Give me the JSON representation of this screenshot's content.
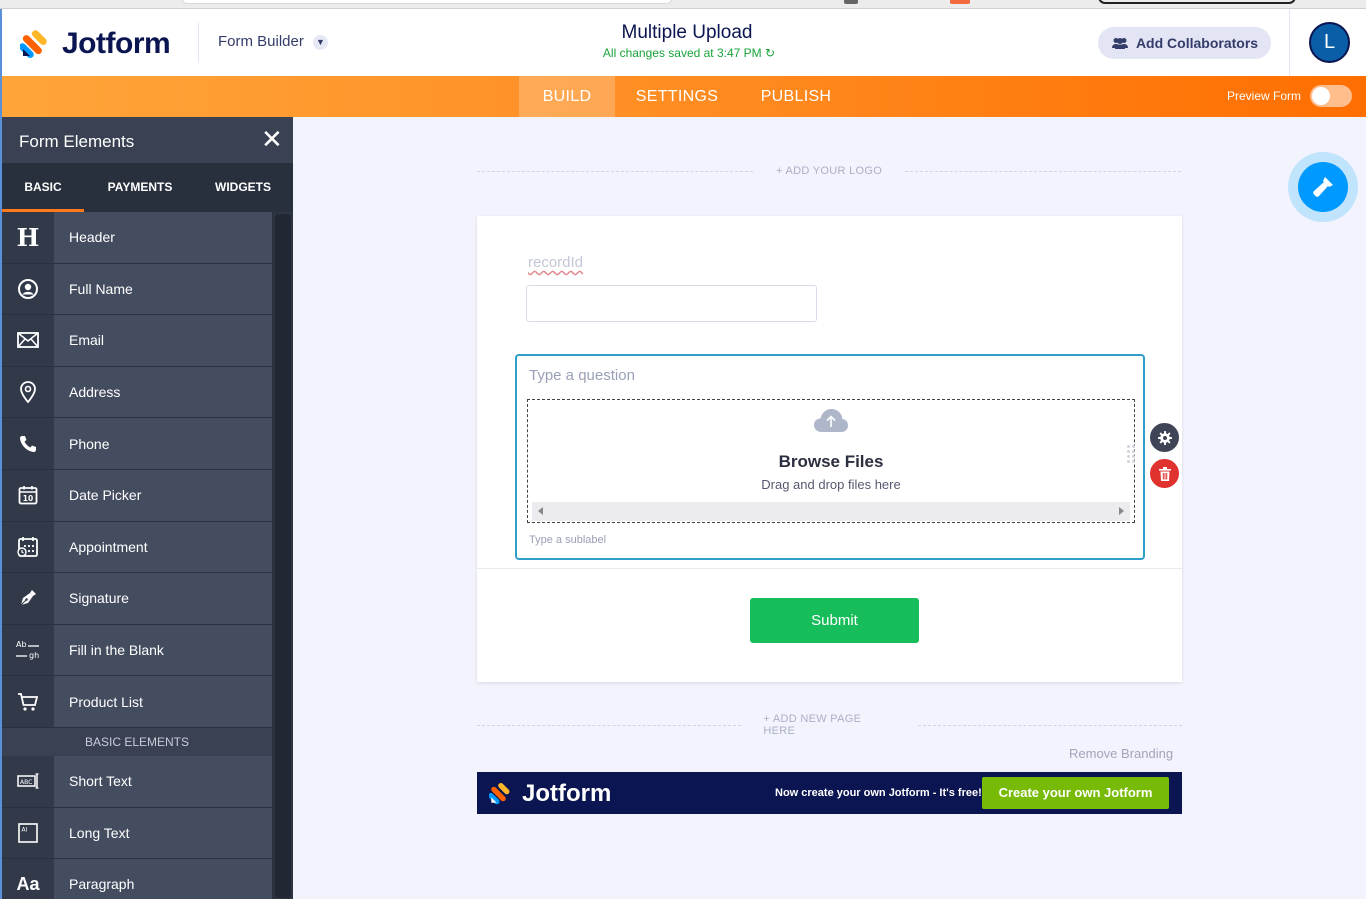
{
  "header": {
    "brand": "Jotform",
    "mode_label": "Form Builder",
    "form_title": "Multiple Upload",
    "save_status": "All changes saved at 3:47 PM",
    "collab_label": "Add Collaborators",
    "avatar_initial": "L"
  },
  "nav": {
    "tabs": [
      {
        "label": "BUILD",
        "active": true
      },
      {
        "label": "SETTINGS",
        "active": false
      },
      {
        "label": "PUBLISH",
        "active": false
      }
    ],
    "preview_label": "Preview Form",
    "preview_on": false
  },
  "sidebar": {
    "title": "Form Elements",
    "tabs": [
      {
        "label": "BASIC",
        "active": true
      },
      {
        "label": "PAYMENTS",
        "active": false
      },
      {
        "label": "WIDGETS",
        "active": false
      }
    ],
    "items": [
      {
        "label": "Header",
        "icon": "header-icon"
      },
      {
        "label": "Full Name",
        "icon": "user-icon"
      },
      {
        "label": "Email",
        "icon": "envelope-icon"
      },
      {
        "label": "Address",
        "icon": "location-pin-icon"
      },
      {
        "label": "Phone",
        "icon": "phone-icon"
      },
      {
        "label": "Date Picker",
        "icon": "calendar-icon"
      },
      {
        "label": "Appointment",
        "icon": "calendar-clock-icon"
      },
      {
        "label": "Signature",
        "icon": "pen-icon"
      },
      {
        "label": "Fill in the Blank",
        "icon": "fill-blank-icon"
      },
      {
        "label": "Product List",
        "icon": "cart-icon"
      }
    ],
    "section_label": "BASIC ELEMENTS",
    "items2": [
      {
        "label": "Short Text",
        "icon": "short-text-icon"
      },
      {
        "label": "Long Text",
        "icon": "long-text-icon"
      },
      {
        "label": "Paragraph",
        "icon": "paragraph-icon"
      }
    ]
  },
  "canvas": {
    "add_logo": "+ ADD YOUR LOGO",
    "field_label": "recordId",
    "field_value": "",
    "upload": {
      "question_placeholder": "Type a question",
      "browse_label": "Browse Files",
      "drag_label": "Drag and drop files here",
      "sublabel_placeholder": "Type a sublabel"
    },
    "submit_label": "Submit",
    "add_page": "+ ADD NEW PAGE HERE",
    "remove_branding": "Remove Branding",
    "banner": {
      "brand": "Jotform",
      "promo": "Now create your own Jotform - It's free!",
      "cta": "Create your own Jotform"
    }
  },
  "colors": {
    "brand_navy": "#0a1551",
    "nav_orange": "#ff8a1f",
    "submit_green": "#18bd5b",
    "focus_blue": "#2e9fc9",
    "delete_red": "#e0322f",
    "fab_blue": "#0099ff"
  }
}
